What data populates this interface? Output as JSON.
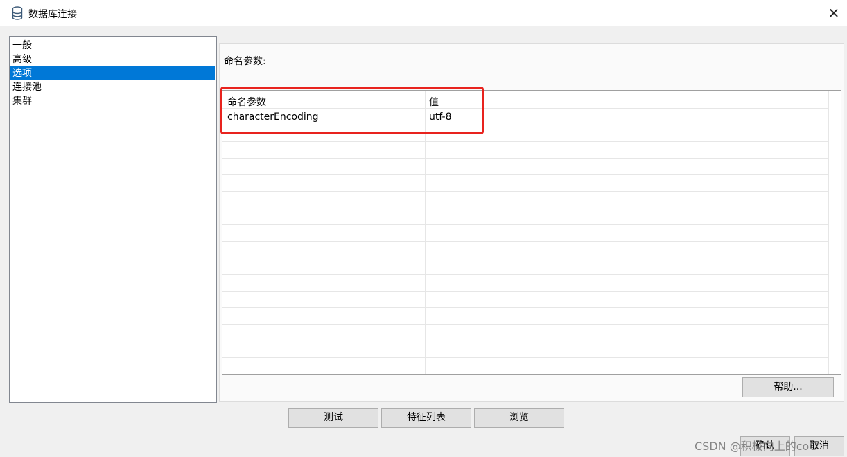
{
  "window": {
    "title": "数据库连接",
    "close_glyph": "✕",
    "icon": "database-icon"
  },
  "nav": {
    "items": [
      {
        "label": "一般",
        "selected": false
      },
      {
        "label": "高级",
        "selected": false
      },
      {
        "label": "选项",
        "selected": true
      },
      {
        "label": "连接池",
        "selected": false
      },
      {
        "label": "集群",
        "selected": false
      }
    ]
  },
  "options": {
    "section_label": "命名参数:",
    "table": {
      "headers": [
        "命名参数",
        "值"
      ],
      "rows": [
        [
          "characterEncoding",
          "utf-8"
        ]
      ]
    },
    "help_button": "帮助..."
  },
  "buttons": {
    "test": "测试",
    "feature_list": "特征列表",
    "browse": "浏览",
    "ok": "确认",
    "cancel": "取消"
  },
  "watermark": "CSDN @积极向上的coC",
  "colors": {
    "selection": "#0078d7",
    "highlight_box": "#e8231e"
  }
}
